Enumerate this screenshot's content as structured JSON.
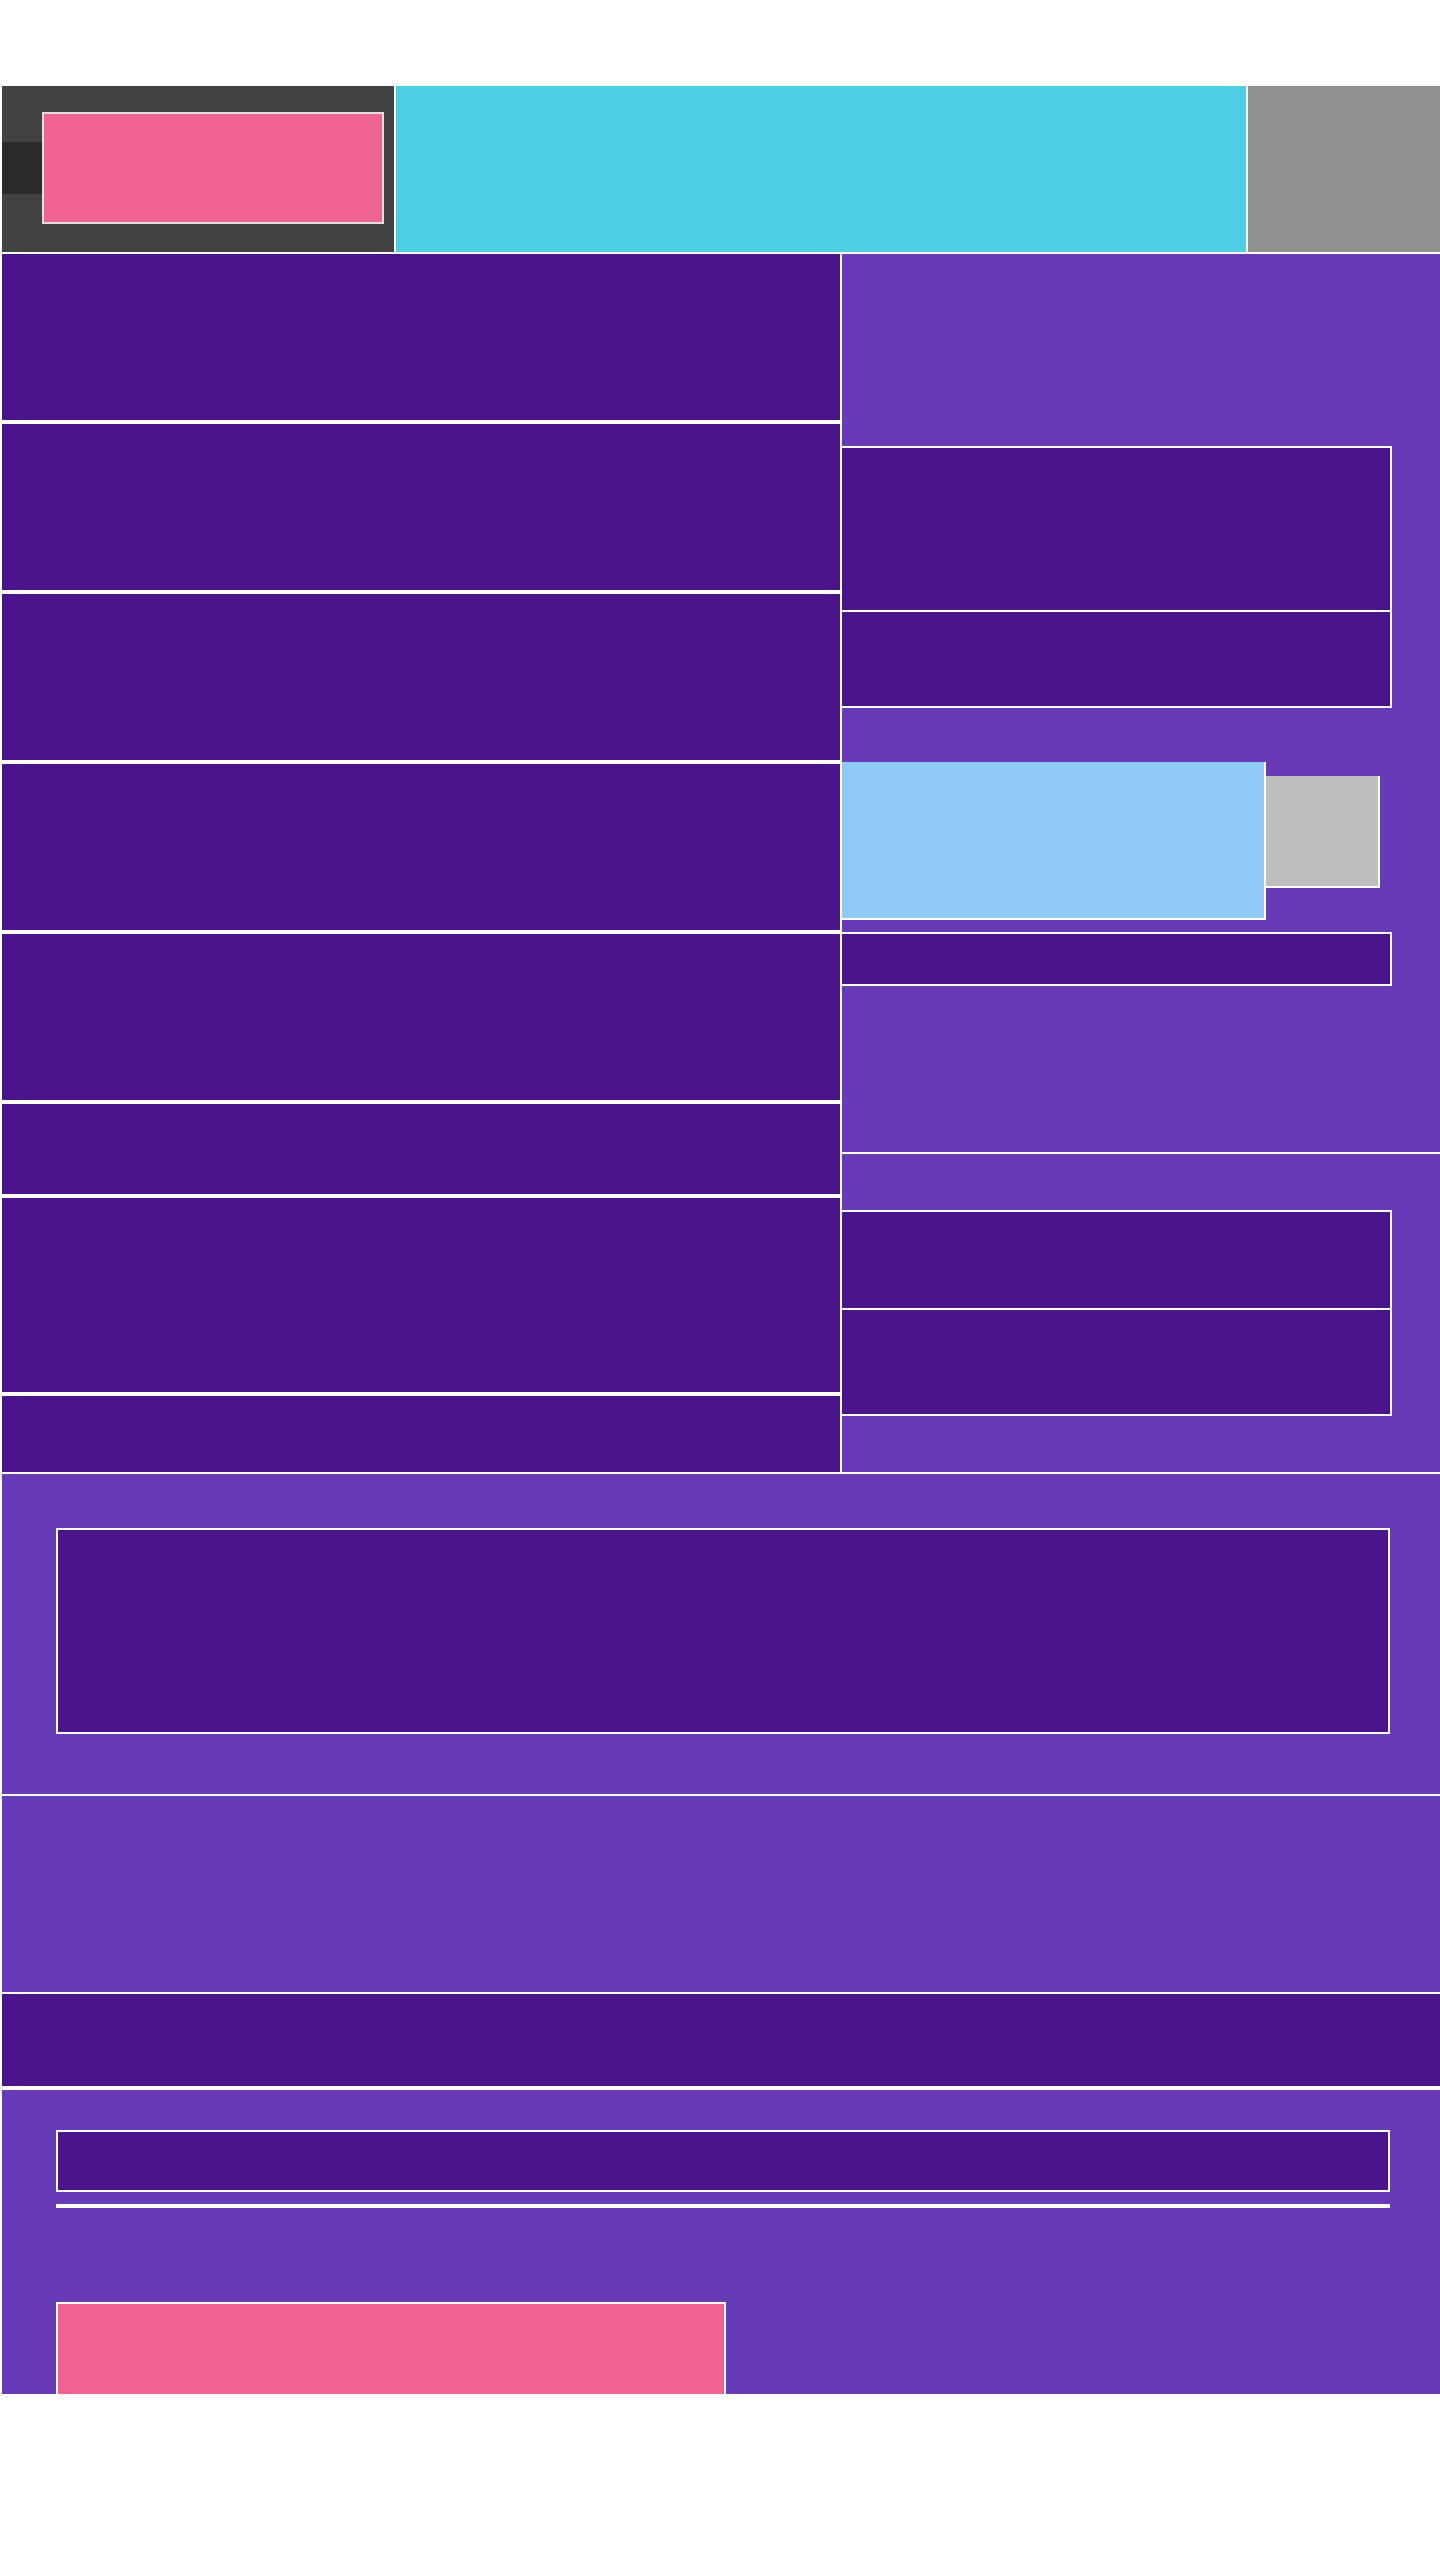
{
  "colors": {
    "header_dark": "#424242",
    "accent_pink": "#f06292",
    "header_cyan": "#4dd0e1",
    "header_grey": "#909090",
    "panel_violet": "#673ab7",
    "row_indigo": "#4a148c",
    "highlight_sky": "#90caf9",
    "swatch_grey": "#bdbdbd",
    "separator": "#ffffff"
  }
}
